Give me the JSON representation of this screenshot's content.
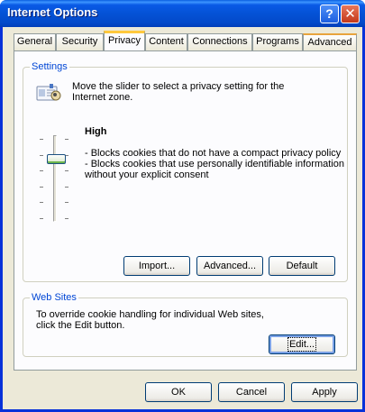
{
  "window": {
    "title": "Internet Options",
    "help_icon": "?",
    "close_icon": "✕"
  },
  "tabs": [
    "General",
    "Security",
    "Privacy",
    "Content",
    "Connections",
    "Programs",
    "Advanced"
  ],
  "settings": {
    "group_label": "Settings",
    "instruction": "Move the slider to select a privacy setting for the Internet zone.",
    "level": "High",
    "level_index": 2,
    "level_count": 6,
    "descriptions": [
      "- Blocks cookies that do not have a compact privacy policy",
      "- Blocks cookies that use personally identifiable information without your explicit consent"
    ],
    "buttons": {
      "import": "Import...",
      "advanced": "Advanced...",
      "default": "Default"
    }
  },
  "websites": {
    "group_label": "Web Sites",
    "text": "To override cookie handling for individual Web sites, click the Edit button.",
    "edit_button": "Edit..."
  },
  "footer": {
    "ok": "OK",
    "cancel": "Cancel",
    "apply": "Apply"
  },
  "colors": {
    "titlebar": "#0452d6",
    "group_label": "#0046d5",
    "active_tab": "#ffc83c"
  }
}
